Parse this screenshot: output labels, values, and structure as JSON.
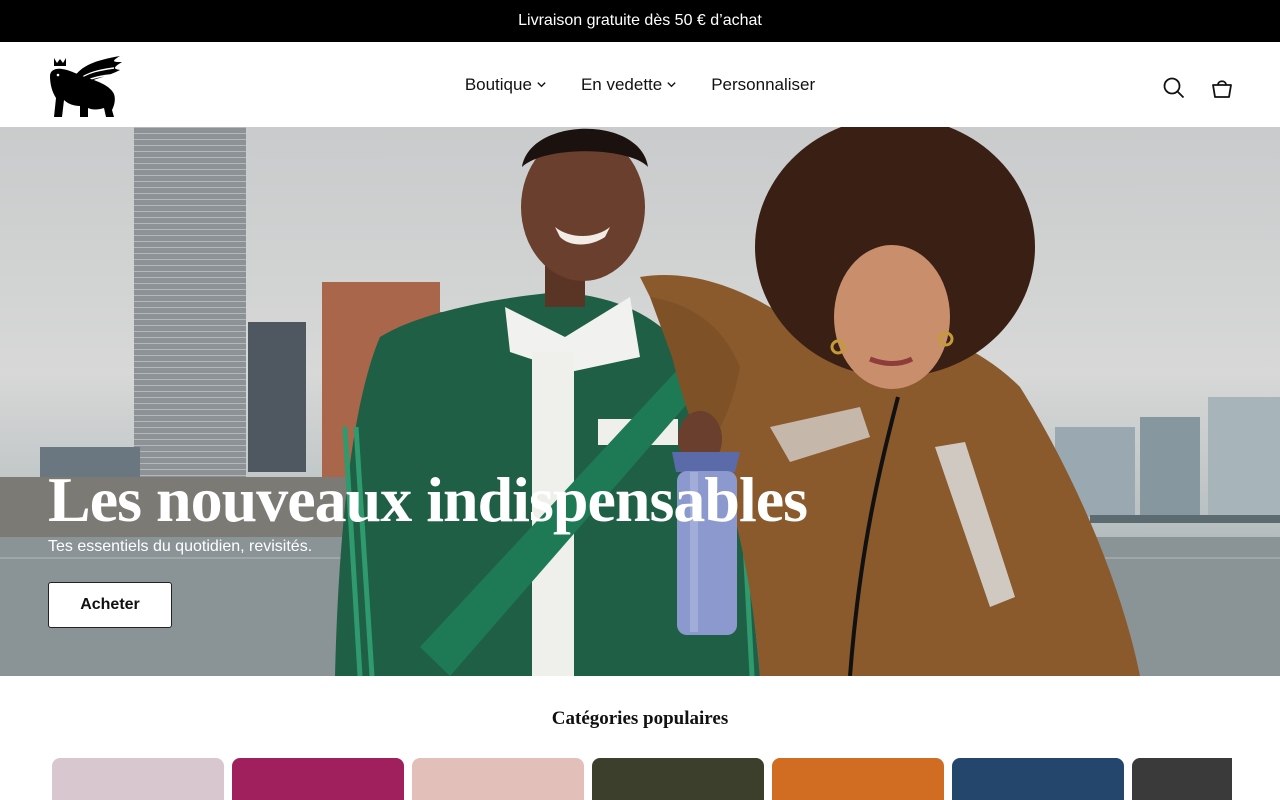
{
  "announcement": {
    "text": "Livraison gratuite dès 50 € d’achat"
  },
  "nav": {
    "items": [
      {
        "label": "Boutique",
        "has_dropdown": true
      },
      {
        "label": "En vedette",
        "has_dropdown": true
      },
      {
        "label": "Personnaliser",
        "has_dropdown": false
      }
    ]
  },
  "header_icons": [
    "search-icon",
    "cart-icon"
  ],
  "hero": {
    "title": "Les nouveaux indispensables",
    "subtitle": "Tes essentiels du quotidien, revisités.",
    "cta_label": "Acheter"
  },
  "categories": {
    "title": "Catégories populaires",
    "cards": [
      {
        "bg": "#d8c7cf",
        "accent": "#efe6ea"
      },
      {
        "bg": "#a0205e",
        "accent": "#e5d3e8"
      },
      {
        "bg": "#e3bfb9",
        "accent": "#f2dcd7"
      },
      {
        "bg": "#3c3f2c",
        "accent": "#5f6b48"
      },
      {
        "bg": "#d06d23",
        "accent": "#f3a23b"
      },
      {
        "bg": "#24466c",
        "accent": "#3f5b7a"
      },
      {
        "bg": "#3a3a3a",
        "accent": "#d8d8d8"
      }
    ]
  },
  "colors": {
    "announcement_bg": "#000000",
    "text": "#111111",
    "hero_text": "#ffffff"
  }
}
